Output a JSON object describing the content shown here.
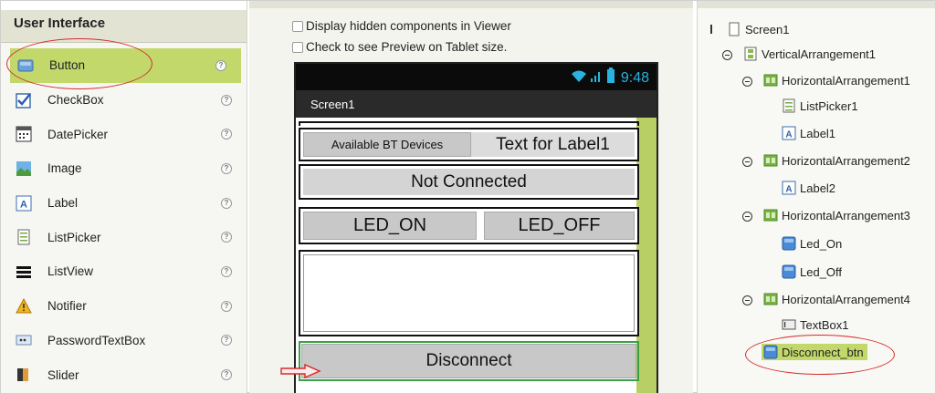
{
  "palette": {
    "header": "User Interface",
    "items": [
      {
        "label": "Button",
        "icon": "button-icon",
        "selected": true
      },
      {
        "label": "CheckBox",
        "icon": "checkbox-icon"
      },
      {
        "label": "DatePicker",
        "icon": "datepicker-icon"
      },
      {
        "label": "Image",
        "icon": "image-icon"
      },
      {
        "label": "Label",
        "icon": "label-icon"
      },
      {
        "label": "ListPicker",
        "icon": "listpicker-icon"
      },
      {
        "label": "ListView",
        "icon": "listview-icon"
      },
      {
        "label": "Notifier",
        "icon": "notifier-icon"
      },
      {
        "label": "PasswordTextBox",
        "icon": "passwordtextbox-icon"
      },
      {
        "label": "Slider",
        "icon": "slider-icon"
      }
    ],
    "help_glyph": "?"
  },
  "viewer": {
    "option_hidden": "Display hidden components in Viewer",
    "option_tablet": "Check to see Preview on Tablet size.",
    "status_time": "9:48",
    "screen_title": "Screen1",
    "available_bt": "Available BT Devices",
    "label1_text": "Text for Label1",
    "not_connected": "Not Connected",
    "led_on": "LED_ON",
    "led_off": "LED_OFF",
    "disconnect": "Disconnect"
  },
  "tree": {
    "nodes": [
      {
        "label": "Screen1"
      },
      {
        "label": "VerticalArrangement1"
      },
      {
        "label": "HorizontalArrangement1"
      },
      {
        "label": "ListPicker1"
      },
      {
        "label": "Label1"
      },
      {
        "label": "HorizontalArrangement2"
      },
      {
        "label": "Label2"
      },
      {
        "label": "HorizontalArrangement3"
      },
      {
        "label": "Led_On"
      },
      {
        "label": "Led_Off"
      },
      {
        "label": "HorizontalArrangement4"
      },
      {
        "label": "TextBox1"
      },
      {
        "label": "Disconnect_btn",
        "selected": true
      }
    ]
  },
  "colors": {
    "selection": "#c3d86b",
    "annotation_red": "#d62a2a",
    "status_blue": "#28b3e0",
    "scrollbar_green": "#b8cf66"
  }
}
